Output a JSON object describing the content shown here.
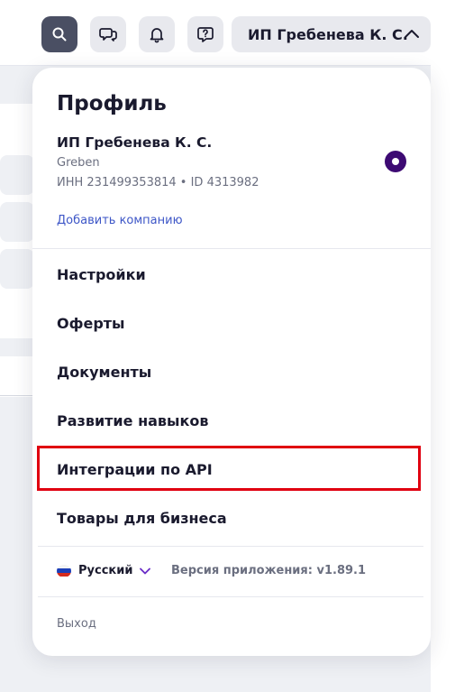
{
  "header": {
    "user_label": "ИП Гребенева К. С.",
    "icons": [
      "search-icon",
      "chat-icon",
      "bell-icon",
      "help-chat-icon",
      "chevron-up-icon"
    ]
  },
  "profile": {
    "title": "Профиль",
    "company_name": "ИП Гребенева К. С.",
    "login": "Greben",
    "ids": "ИНН 231499353814 • ID 4313982",
    "add_company": "Добавить компанию"
  },
  "menu": {
    "items": [
      {
        "label": "Настройки"
      },
      {
        "label": "Оферты"
      },
      {
        "label": "Документы"
      },
      {
        "label": "Развитие навыков"
      },
      {
        "label": "Интеграции по API"
      },
      {
        "label": "Товары для бизнеса"
      }
    ]
  },
  "footer": {
    "language": "Русский",
    "version": "Версия приложения: v1.89.1",
    "logout": "Выход"
  },
  "colors": {
    "accent_purple": "#3d0a73",
    "link_blue": "#3d56c7",
    "highlight_red": "#e00010"
  }
}
